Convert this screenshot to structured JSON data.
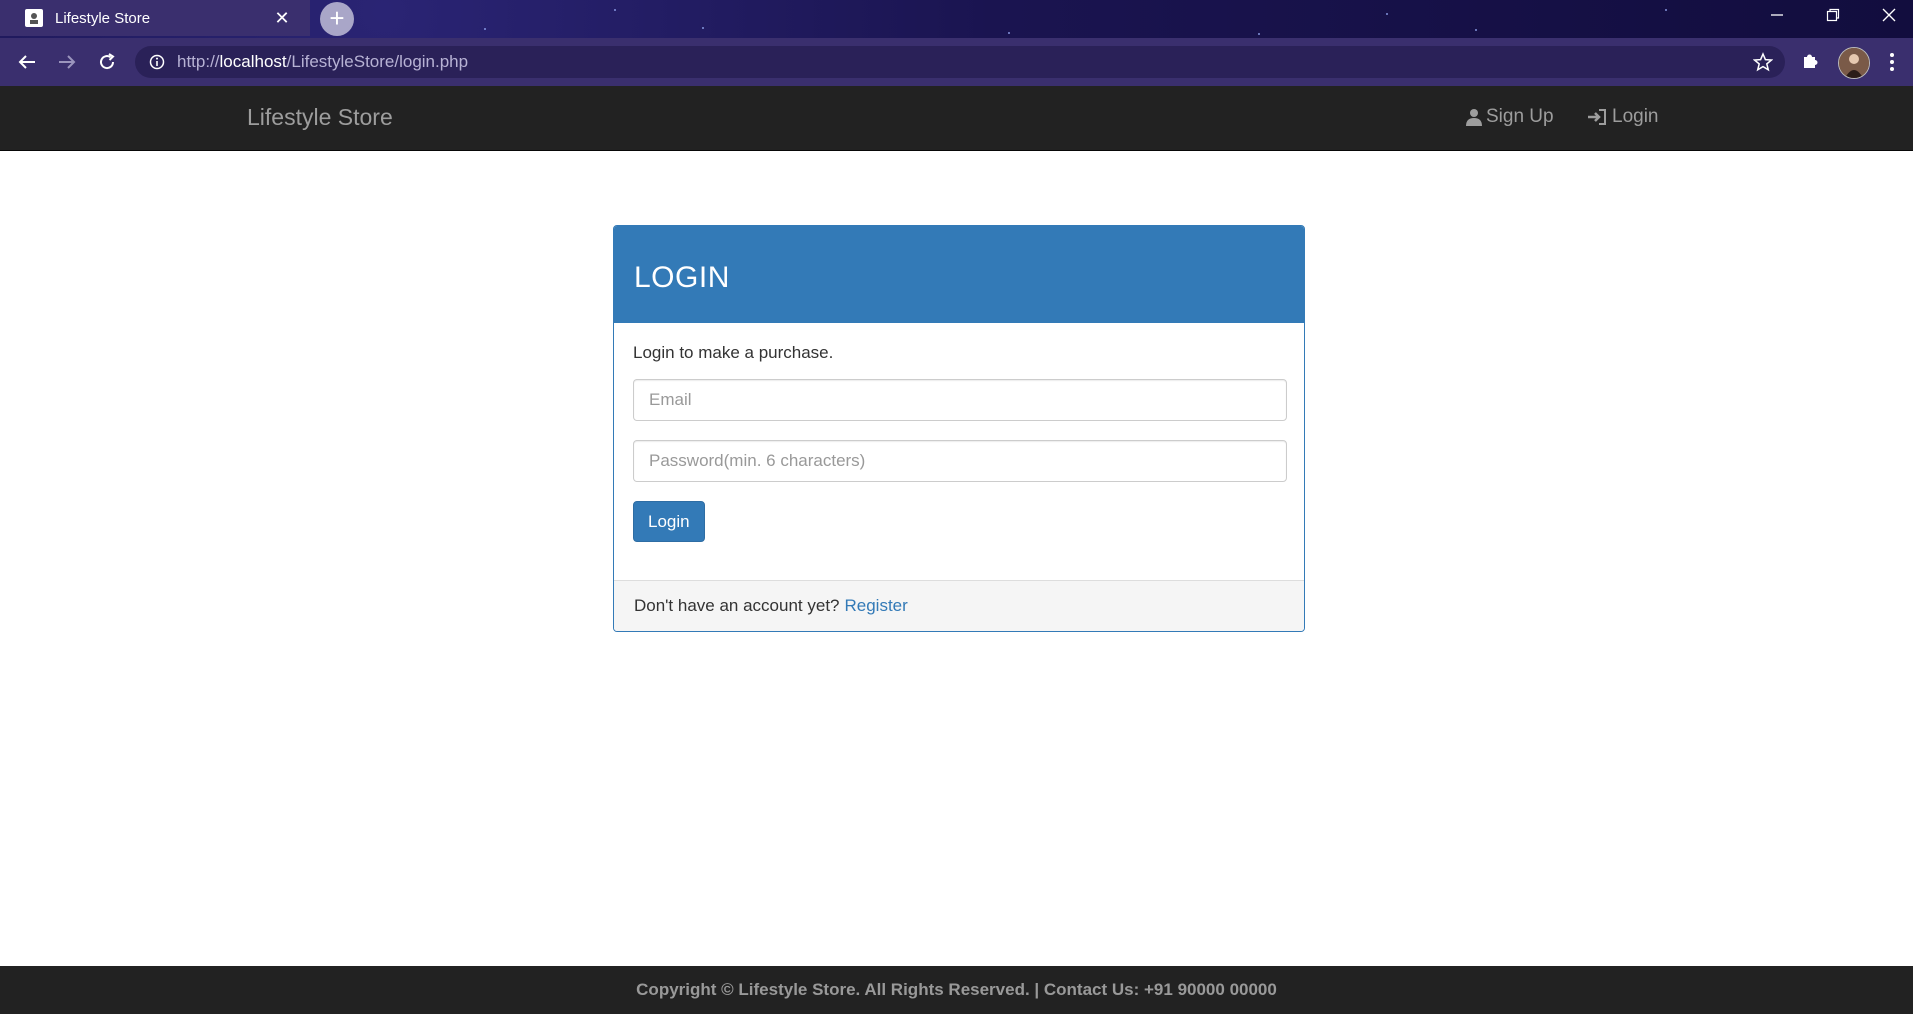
{
  "browser": {
    "tab_title": "Lifestyle Store",
    "new_tab_symbol": "+",
    "close_symbol": "✕",
    "url_scheme": "http://",
    "url_host": "localhost",
    "url_path": "/LifestyleStore/login.php",
    "window_controls": [
      "—",
      "❐",
      "✕"
    ]
  },
  "navbar": {
    "brand": "Lifestyle Store",
    "signup_label": "Sign Up",
    "login_label": "Login"
  },
  "panel": {
    "heading": "LOGIN",
    "intro": "Login to make a purchase.",
    "email_placeholder": "Email",
    "password_placeholder": "Password(min. 6 characters)",
    "submit_label": "Login",
    "footer_text": "Don't have an account yet?",
    "register_link": "Register"
  },
  "footer": {
    "text": "Copyright © Lifestyle Store. All Rights Reserved. | Contact Us: +91 90000 00000"
  },
  "colors": {
    "primary": "#337ab7",
    "navbar_bg": "#222222",
    "browser_bg": "#3a2f6e"
  }
}
